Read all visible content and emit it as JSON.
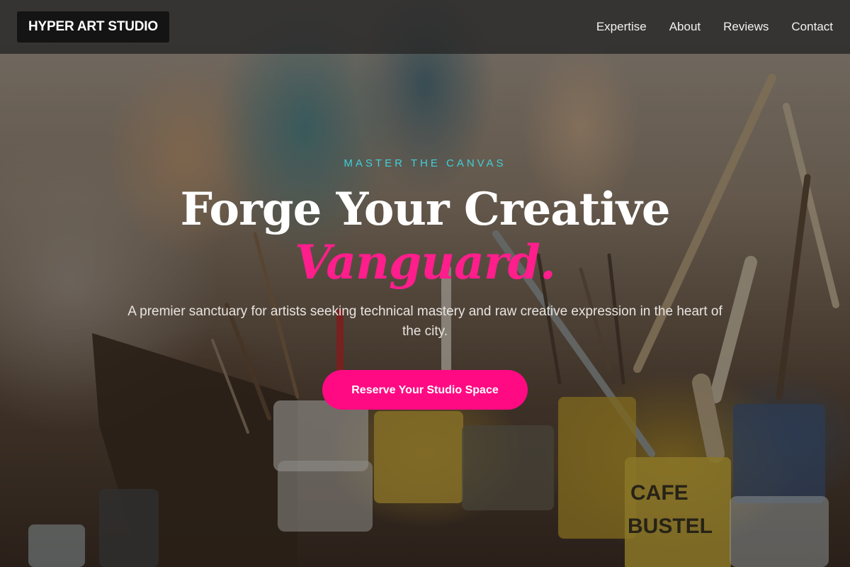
{
  "header": {
    "logo_text": "HYPER ART STUDIO",
    "nav": [
      {
        "label": "Expertise"
      },
      {
        "label": "About"
      },
      {
        "label": "Reviews"
      },
      {
        "label": "Contact"
      }
    ]
  },
  "hero": {
    "eyebrow": "MASTER THE CANVAS",
    "headline_line1": "Forge Your Creative",
    "headline_line2": "Vanguard.",
    "subtitle": "A premier sanctuary for artists seeking technical mastery and raw creative expression in the heart of the city.",
    "cta_label": "Reserve Your Studio Space",
    "background_image": "art-studio-paint-brushes-photo"
  },
  "colors": {
    "accent_pink": "#ff0a83",
    "eyebrow_teal": "#3fd0d8",
    "header_bg": "#282828"
  }
}
